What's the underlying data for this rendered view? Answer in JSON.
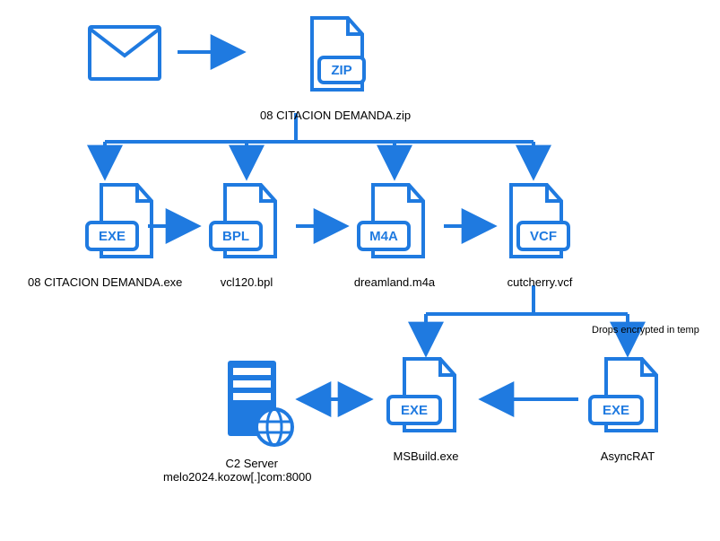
{
  "diagram": {
    "zip_label": "08 CITACION DEMANDA.zip",
    "exe_label": "08 CITACION DEMANDA.exe",
    "bpl_label": "vcl120.bpl",
    "m4a_label": "dreamland.m4a",
    "vcf_label": "cutcherry.vcf",
    "c2_label1": "C2 Server",
    "c2_label2": "melo2024.kozow[.]com:8000",
    "msbuild_label": "MSBuild.exe",
    "asyncrat_label": "AsyncRAT",
    "drops_label": "Drops encrypted in temp",
    "badges": {
      "zip": "ZIP",
      "exe": "EXE",
      "bpl": "BPL",
      "m4a": "M4A",
      "vcf": "VCF"
    }
  },
  "chart_data": {
    "type": "flow-diagram",
    "nodes": [
      {
        "id": "email",
        "kind": "email-icon",
        "label": ""
      },
      {
        "id": "zip",
        "kind": "file",
        "badge": "ZIP",
        "label": "08 CITACION DEMANDA.zip"
      },
      {
        "id": "exe",
        "kind": "file",
        "badge": "EXE",
        "label": "08 CITACION DEMANDA.exe"
      },
      {
        "id": "bpl",
        "kind": "file",
        "badge": "BPL",
        "label": "vcl120.bpl"
      },
      {
        "id": "m4a",
        "kind": "file",
        "badge": "M4A",
        "label": "dreamland.m4a"
      },
      {
        "id": "vcf",
        "kind": "file",
        "badge": "VCF",
        "label": "cutcherry.vcf"
      },
      {
        "id": "c2",
        "kind": "server",
        "label": "C2 Server",
        "sublabel": "melo2024.kozow[.]com:8000"
      },
      {
        "id": "msbuild",
        "kind": "file",
        "badge": "EXE",
        "label": "MSBuild.exe"
      },
      {
        "id": "asyncrat",
        "kind": "file",
        "badge": "EXE",
        "label": "AsyncRAT"
      }
    ],
    "edges": [
      {
        "from": "email",
        "to": "zip",
        "style": "arrow"
      },
      {
        "from": "zip",
        "to": "exe",
        "style": "branch-down"
      },
      {
        "from": "zip",
        "to": "bpl",
        "style": "branch-down"
      },
      {
        "from": "zip",
        "to": "m4a",
        "style": "branch-down"
      },
      {
        "from": "zip",
        "to": "vcf",
        "style": "branch-down"
      },
      {
        "from": "exe",
        "to": "bpl",
        "style": "arrow"
      },
      {
        "from": "bpl",
        "to": "m4a",
        "style": "arrow"
      },
      {
        "from": "m4a",
        "to": "vcf",
        "style": "arrow"
      },
      {
        "from": "vcf",
        "to": "msbuild",
        "style": "branch-down"
      },
      {
        "from": "vcf",
        "to": "asyncrat",
        "style": "branch-down",
        "label": "Drops encrypted in temp"
      },
      {
        "from": "asyncrat",
        "to": "msbuild",
        "style": "arrow"
      },
      {
        "from": "msbuild",
        "to": "c2",
        "style": "bidirectional"
      }
    ]
  }
}
